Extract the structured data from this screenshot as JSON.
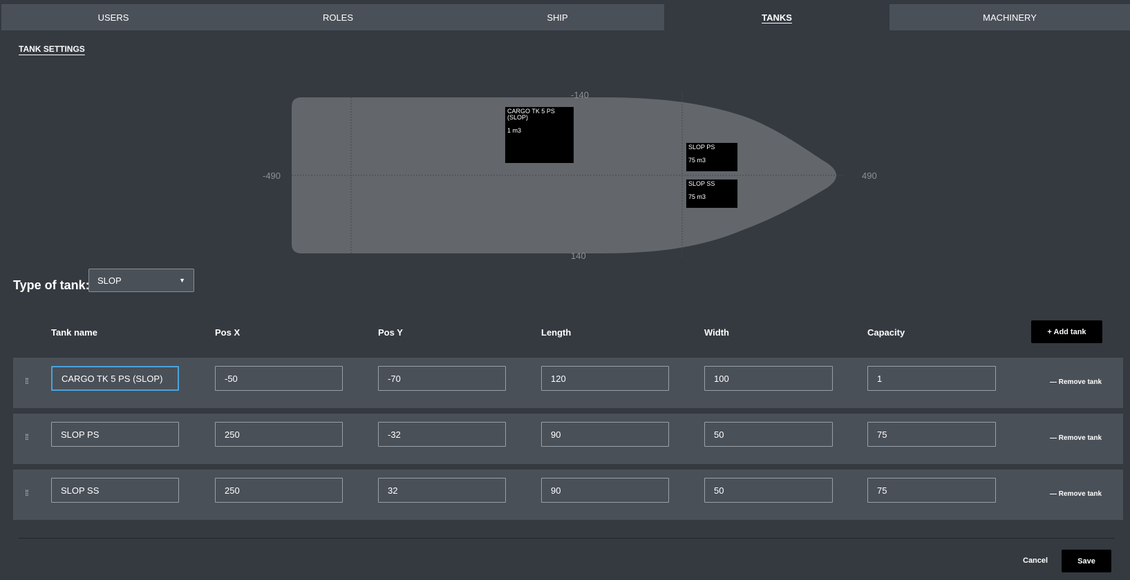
{
  "tabs": [
    {
      "label": "USERS"
    },
    {
      "label": "ROLES"
    },
    {
      "label": "SHIP"
    },
    {
      "label": "TANKS"
    },
    {
      "label": "MACHINERY"
    }
  ],
  "active_tab": "TANKS",
  "section_title": "TANK SETTINGS",
  "diagram": {
    "axis": {
      "top": "-140",
      "bottom": "140",
      "left": "-490",
      "right": "490"
    },
    "hull_color": "#63676c",
    "tanks": [
      {
        "name": "CARGO TK 5 PS (SLOP)",
        "capacity": "1 m3"
      },
      {
        "name": "SLOP PS",
        "capacity": "75 m3"
      },
      {
        "name": "SLOP SS",
        "capacity": "75 m3"
      }
    ]
  },
  "type_of_tank": {
    "label": "Type of tank:",
    "value": "SLOP"
  },
  "table": {
    "headers": {
      "name": "Tank name",
      "pos_x": "Pos X",
      "pos_y": "Pos Y",
      "length": "Length",
      "width": "Width",
      "capacity": "Capacity"
    },
    "add_label": "+ Add tank",
    "remove_label": "— Remove tank",
    "rows": [
      {
        "name": "CARGO TK 5 PS (SLOP)",
        "pos_x": "-50",
        "pos_y": "-70",
        "length": "120",
        "width": "100",
        "capacity": "1"
      },
      {
        "name": "SLOP PS",
        "pos_x": "250",
        "pos_y": "-32",
        "length": "90",
        "width": "50",
        "capacity": "75"
      },
      {
        "name": "SLOP SS",
        "pos_x": "250",
        "pos_y": "32",
        "length": "90",
        "width": "50",
        "capacity": "75"
      }
    ]
  },
  "footer": {
    "cancel": "Cancel",
    "save": "Save"
  }
}
